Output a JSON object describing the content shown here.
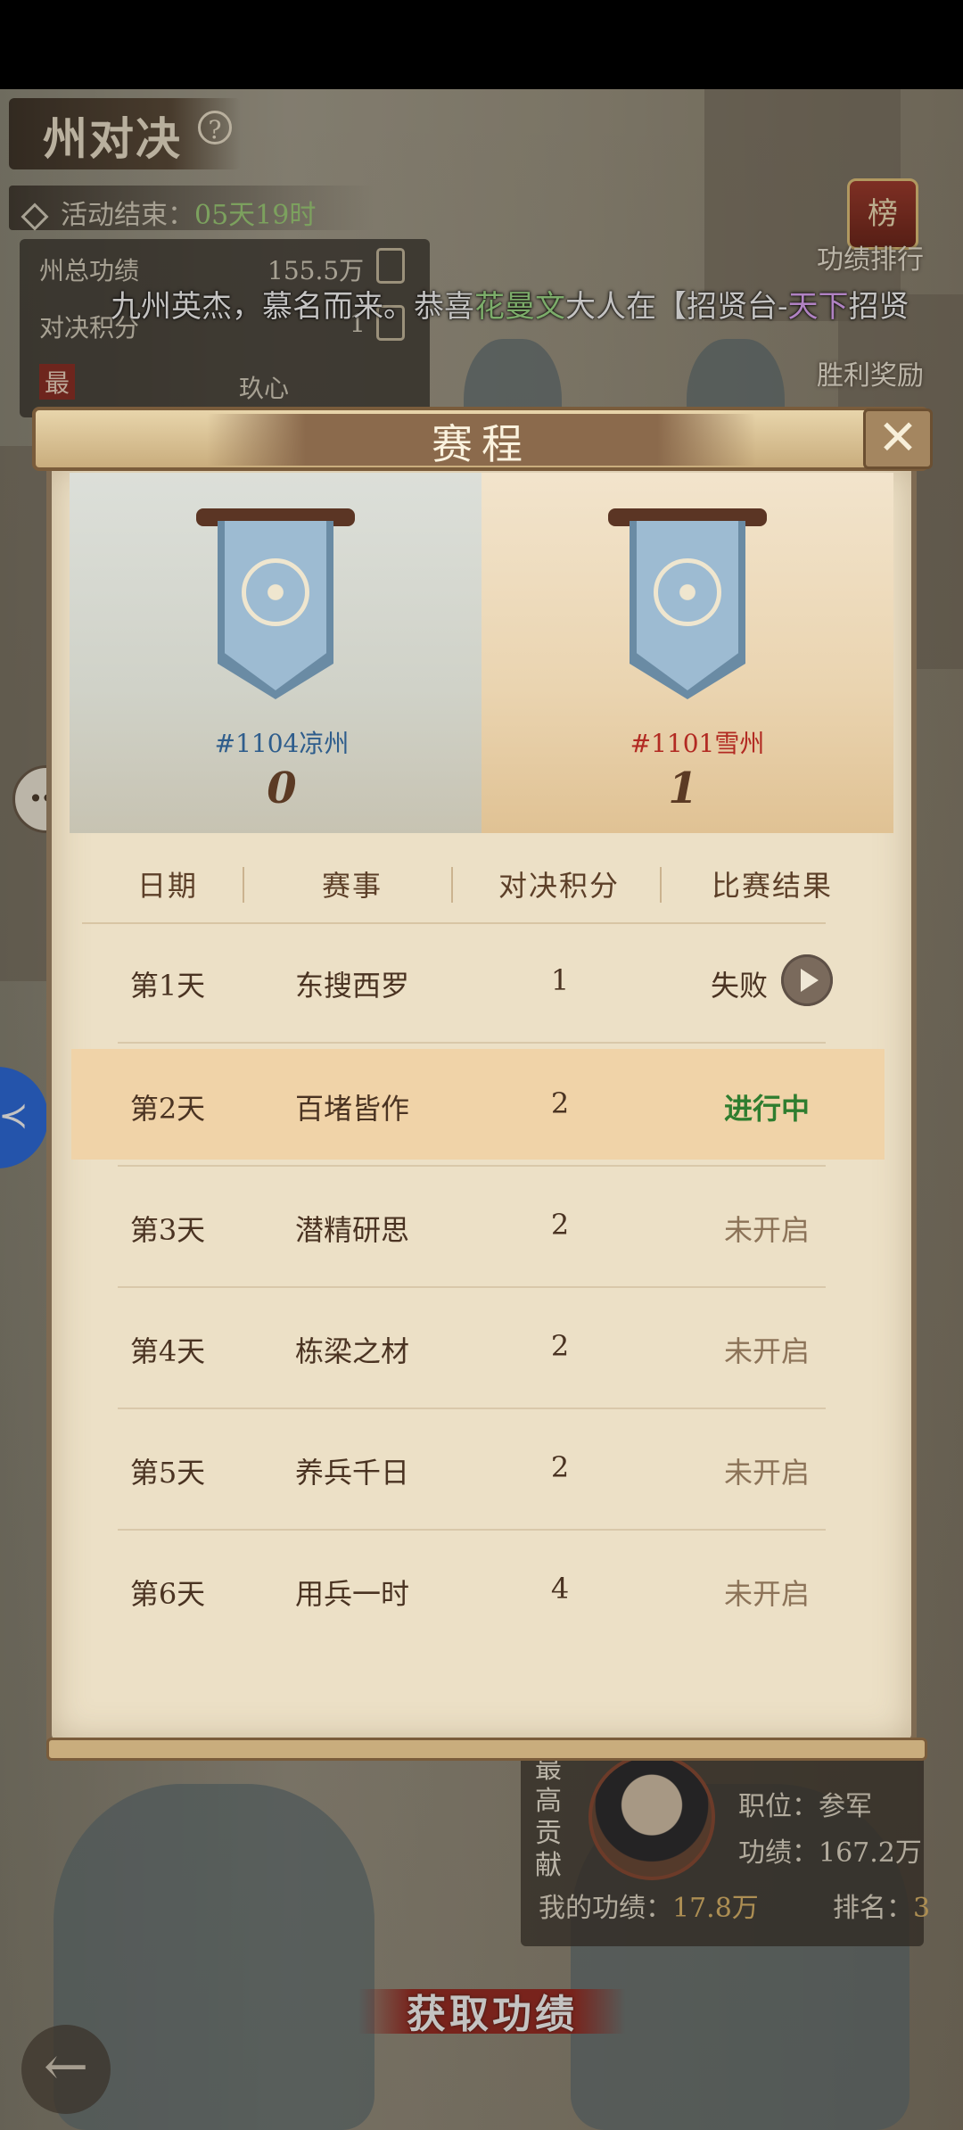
{
  "header": {
    "title": "州对决",
    "event_end_label": "活动结束：",
    "event_end_value": "05天19时"
  },
  "stats": {
    "state_merit_label": "州总功绩",
    "state_merit_value": "155.5万",
    "duel_score_label": "对决积分",
    "duel_score_value": "1",
    "most_label": "最",
    "name_fragment": "玖心"
  },
  "right_menu": {
    "merit_rank": "功绩排行",
    "victory_reward": "胜利奖励",
    "rank_icon_char": "榜"
  },
  "marquee": {
    "prefix": "九州英杰，慕名而来。恭喜",
    "player": "花曼文",
    "middle": "大人在【招贤台-",
    "tag": "天下",
    "suffix": "招贤"
  },
  "chat": {
    "badge": "..."
  },
  "modal": {
    "title": "赛程",
    "close_glyph": "✕",
    "team_left": {
      "name": "#1104凉州",
      "score": "0",
      "color": "#2e5d8c"
    },
    "team_right": {
      "name": "#1101雪州",
      "score": "1",
      "color": "#b22a22"
    },
    "table": {
      "headers": [
        "日期",
        "赛事",
        "对决积分",
        "比赛结果"
      ],
      "rows": [
        {
          "day": "第1天",
          "event": "东搜西罗",
          "score": "1",
          "result": "失败",
          "status": "lose"
        },
        {
          "day": "第2天",
          "event": "百堵皆作",
          "score": "2",
          "result": "进行中",
          "status": "going"
        },
        {
          "day": "第3天",
          "event": "潜精研思",
          "score": "2",
          "result": "未开启",
          "status": "wait"
        },
        {
          "day": "第4天",
          "event": "栋梁之材",
          "score": "2",
          "result": "未开启",
          "status": "wait"
        },
        {
          "day": "第5天",
          "event": "养兵千日",
          "score": "2",
          "result": "未开启",
          "status": "wait"
        },
        {
          "day": "第6天",
          "event": "用兵一时",
          "score": "4",
          "result": "未开启",
          "status": "wait"
        }
      ]
    }
  },
  "player_card": {
    "side_label": "最高贡献",
    "position_label": "职位：",
    "position_value": "参军",
    "merit_label": "功绩：",
    "merit_value": "167.2万",
    "my_merit_label": "我的功绩：",
    "my_merit_value": "17.8万",
    "rank_label": "排名：",
    "rank_value": "3"
  },
  "bottom": {
    "get_merit": "获取功绩",
    "back_glyph": "←"
  },
  "colors": {
    "paper": "#ece0c6",
    "highlight_row": "#f0d3a8",
    "in_progress": "#2f7d2f",
    "accent_red": "#9a2a22"
  }
}
